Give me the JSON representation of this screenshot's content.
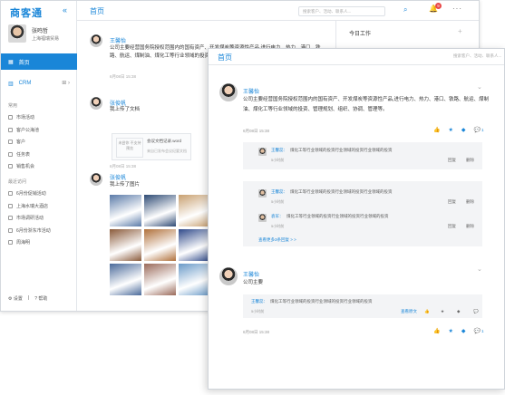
{
  "back": {
    "sidebar": {
      "logo": "商客通",
      "collapse_icon": "«",
      "user": {
        "name": "张鸣哲",
        "company": "上海福瑞贸易"
      },
      "nav_home": "首页",
      "nav_crm": "CRM",
      "common_title": "常用",
      "common_items": [
        "市场活动",
        "客户公海池",
        "客户",
        "任务表",
        "销售机会"
      ],
      "recent_title": "最近访问",
      "recent_items": [
        "6月份促销活动",
        "上海水瑞大酒店",
        "市场调研活动",
        "6月份浙东市活动",
        "周海明"
      ],
      "settings": "设置",
      "help": "帮助"
    },
    "topbar": {
      "title": "首页",
      "search_placeholder": "搜索客户、活动、联系人...",
      "badge_count": "9"
    },
    "feed": {
      "post1": {
        "name": "王馨怡",
        "text": "公司主要经营国务院授权范围内的国有资产、开发煤炭等资源性产品,进行电力、热力、港口、铁路、航运、煤制油、煤化工等行业领域的投资、管理规划、组织、协调、管理等。",
        "time": "6月08日 15:38"
      },
      "post2": {
        "name": "张俊帆",
        "text": "我上传了文档",
        "attachment_thumb": "未尝你 不支持预览",
        "attachment_title": "会议文档记录.word",
        "attachment_meta": "来自已发布会议纪要文档",
        "time": "6月08日 15:38"
      },
      "post3": {
        "name": "张俊帆",
        "text": "我上传了图片"
      }
    },
    "todo": {
      "title": "今日工作"
    }
  },
  "front": {
    "title": "首页",
    "search_placeholder": "搜索客户、活动、联系人...",
    "post1": {
      "name": "王馨怡",
      "text": "公司主要经营国务院授权范围内的国有资产、开发煤炭等资源性产品,进行电力、热力、港口、铁路、航运、煤制油、煤化工等行业领域的投资、管理规划、组织、协调、管理等。",
      "time": "6月08日 15:38",
      "comment_count": "1",
      "comments": [
        {
          "name": "王馨蕊：",
          "text": "煤化工等行业领域的投资行业领域的投资行业领域的投资",
          "time": "5小时前",
          "reply": "回复",
          "delete": "删除"
        },
        {
          "name": "王馨蕊：",
          "text": "煤化工等行业领域的投资行业领域的投资行业领域的投资",
          "time": "5小时前",
          "reply": "回复",
          "delete": "删除"
        },
        {
          "name": "袁军：",
          "text": "煤化工等行业领域的投资行业领域的投资行业领域的投资",
          "time": "5小时前",
          "reply": "回复",
          "delete": "删除"
        }
      ],
      "more_replies": "查看更多3条回复 > >"
    },
    "post2": {
      "name": "王馨怡",
      "text": "公司主要",
      "time": "6月08日 15:38",
      "comment_count": "1",
      "comment": {
        "name": "王馨蕊：",
        "text": "煤化工等行业领域的投资行业领域的投资行业领域的投资",
        "time": "5小时前",
        "view_original": "查看原文",
        "reply": "回复",
        "delete": "删除"
      }
    }
  },
  "colors": {
    "accent": "#1a86d8",
    "badge": "#e94848"
  },
  "photo_colors": [
    [
      "#5a7aa8",
      "#2d4a74",
      "#c8a070",
      "#e6d2b0"
    ],
    [
      "#8a5a3a",
      "#b0703a",
      "#304a8a",
      "#6a4a9a"
    ],
    [
      "#4a6a9a",
      "#9a6a5a",
      "#6a9ac8",
      "#3a2a2a"
    ]
  ]
}
